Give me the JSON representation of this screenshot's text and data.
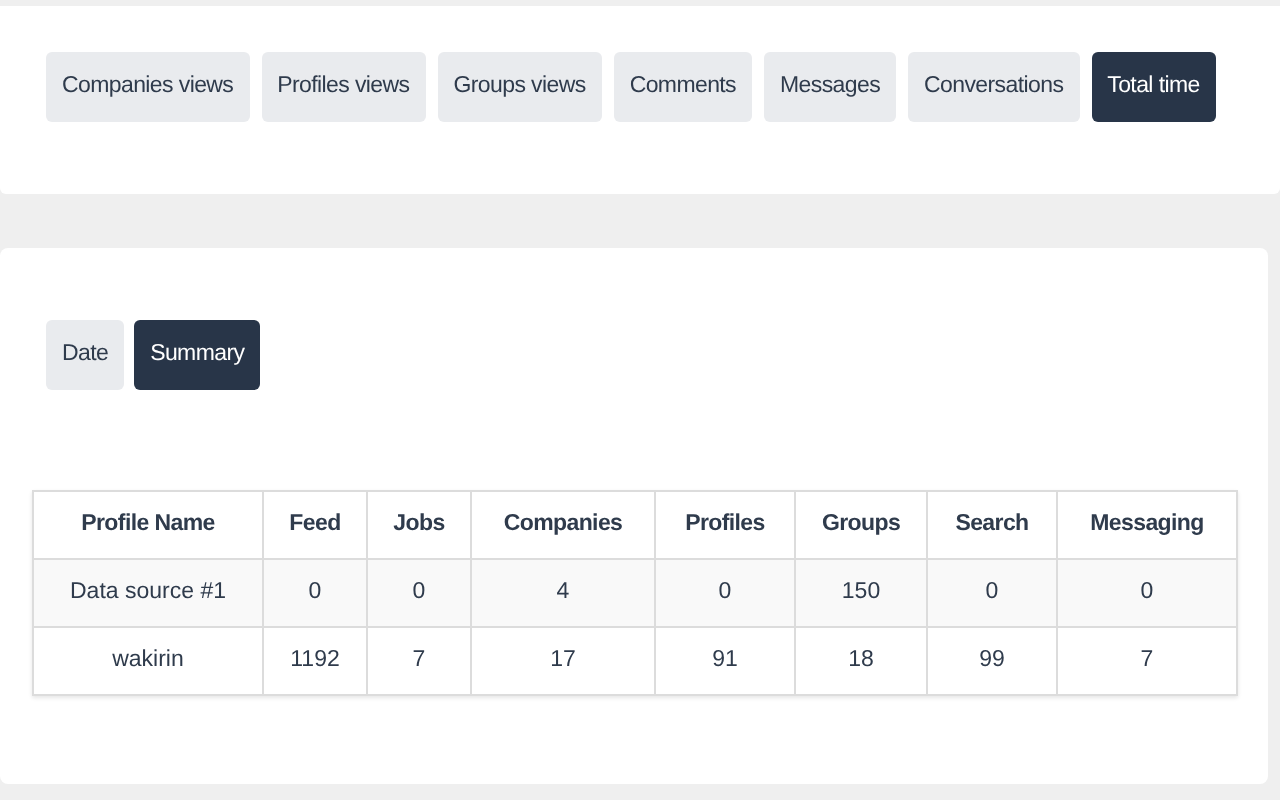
{
  "metric_tabs": [
    {
      "label": "Companies views",
      "selected": false
    },
    {
      "label": "Profiles views",
      "selected": false
    },
    {
      "label": "Groups views",
      "selected": false
    },
    {
      "label": "Comments",
      "selected": false
    },
    {
      "label": "Messages",
      "selected": false
    },
    {
      "label": "Conversations",
      "selected": false
    },
    {
      "label": "Total time",
      "selected": true
    }
  ],
  "view_tabs": [
    {
      "label": "Date",
      "selected": false
    },
    {
      "label": "Summary",
      "selected": true
    }
  ],
  "table": {
    "columns": [
      "Profile Name",
      "Feed",
      "Jobs",
      "Companies",
      "Profiles",
      "Groups",
      "Search",
      "Messaging"
    ],
    "rows": [
      [
        "Data source #1",
        "0",
        "0",
        "4",
        "0",
        "150",
        "0",
        "0"
      ],
      [
        "wakirin",
        "1192",
        "7",
        "17",
        "91",
        "18",
        "99",
        "7"
      ]
    ]
  }
}
